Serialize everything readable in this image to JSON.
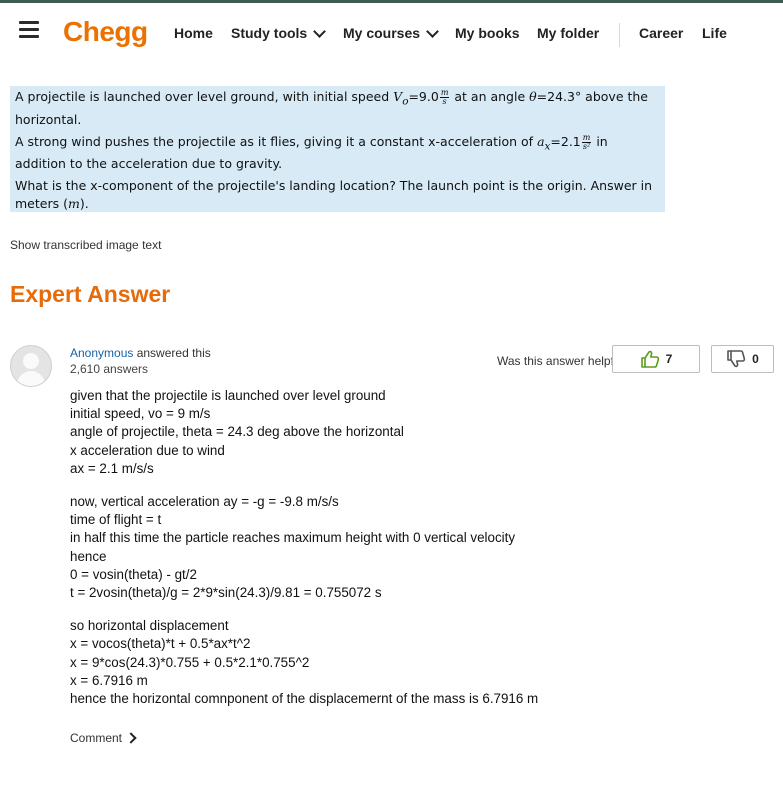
{
  "header": {
    "logo": "Chegg",
    "nav": [
      {
        "label": "Home"
      },
      {
        "label": "Study tools"
      },
      {
        "label": "My courses"
      },
      {
        "label": "My books"
      },
      {
        "label": "My folder"
      },
      {
        "label": "Career"
      },
      {
        "label": "Life"
      }
    ]
  },
  "question": {
    "p1_pre": "A projectile is launched over level ground, with initial speed ",
    "p1_v": "V",
    "p1_vsub": "o",
    "p1_eq": "=9.0",
    "unit_num": "m",
    "unit_den": "s",
    "p1_mid": " at an angle ",
    "p1_theta": "θ",
    "p1_post": "=24.3° above the horizontal.",
    "p2_pre": "A strong wind pushes the projectile as it flies, giving it a constant x-acceleration of ",
    "p2_a": "a",
    "p2_asub": "x",
    "p2_eq": "=2.1",
    "unit2_num": "m",
    "unit2_den": "s²",
    "p2_post": " in addition to the acceleration due to gravity.",
    "p3_pre": "What is the x-component of the projectile's landing location? The launch point is the origin. Answer in meters (",
    "p3_m": "m",
    "p3_post": ")."
  },
  "show_transcribed": "Show transcribed image text",
  "expert_answer_title": "Expert Answer",
  "answerer": {
    "name": "Anonymous",
    "suffix": " answered this",
    "count": "2,610 answers"
  },
  "helpful": {
    "label": "Was this answer helpful?",
    "upvotes": "7",
    "downvotes": "0"
  },
  "answer_lines": {
    "l1": "given that the projectile is launched over level ground",
    "l2": "initial speed, vo = 9 m/s",
    "l3": "angle of projectile, theta = 24.3 deg above the horizontal",
    "l4": "x acceleration due to wind",
    "l5": "ax = 2.1 m/s/s",
    "l6": "now, vertical acceleration ay = -g = -9.8 m/s/s",
    "l7": "time of flight = t",
    "l8": "in half this time the particle reaches maximum height with 0 vertical velocity",
    "l9": "hence",
    "l10": "0 = vosin(theta) - gt/2",
    "l11": "t = 2vosin(theta)/g = 2*9*sin(24.3)/9.81 = 0.755072 s",
    "l12": "so horizontal displacement",
    "l13": "x = vocos(theta)*t + 0.5*ax*t^2",
    "l14": "x = 9*cos(24.3)*0.755 + 0.5*2.1*0.755^2",
    "l15": "x = 6.7916 m",
    "l16": "hence the horizontal comnponent of the displacemernt of the mass is 6.7916 m"
  },
  "comment_label": "Comment"
}
